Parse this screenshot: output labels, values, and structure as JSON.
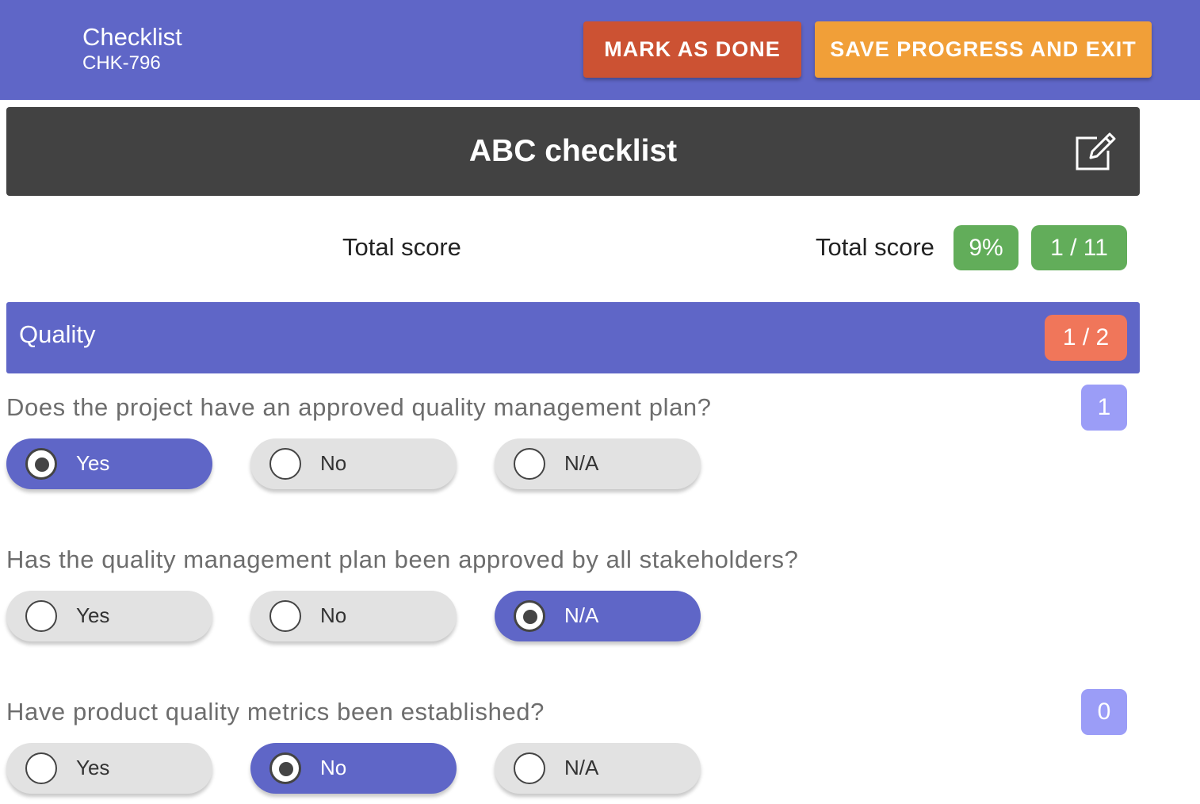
{
  "header": {
    "title": "Checklist",
    "subtitle": "CHK-796",
    "mark_done_label": "MARK AS DONE",
    "save_exit_label": "SAVE PROGRESS AND EXIT"
  },
  "checklist": {
    "title": "ABC checklist",
    "edit_icon": "edit-icon"
  },
  "score": {
    "left_label": "Total score",
    "right_label": "Total score",
    "percent": "9%",
    "count": "1 / 11"
  },
  "section": {
    "title": "Quality",
    "count": "1 / 2"
  },
  "questions": [
    {
      "text": "Does the project have an approved quality management plan?",
      "score": "1",
      "options": [
        "Yes",
        "No",
        "N/A"
      ],
      "selected": "Yes"
    },
    {
      "text": "Has the quality management plan been approved by all stakeholders?",
      "score": "",
      "options": [
        "Yes",
        "No",
        "N/A"
      ],
      "selected": "N/A"
    },
    {
      "text": "Have product quality metrics been established?",
      "score": "0",
      "options": [
        "Yes",
        "No",
        "N/A"
      ],
      "selected": "No"
    }
  ],
  "colors": {
    "primary": "#5f66c7",
    "danger": "#cc5233",
    "warning": "#f19f38",
    "success": "#62ad5a",
    "section_badge": "#f0765a",
    "score_badge": "#9b9df7",
    "header_card": "#424242"
  }
}
